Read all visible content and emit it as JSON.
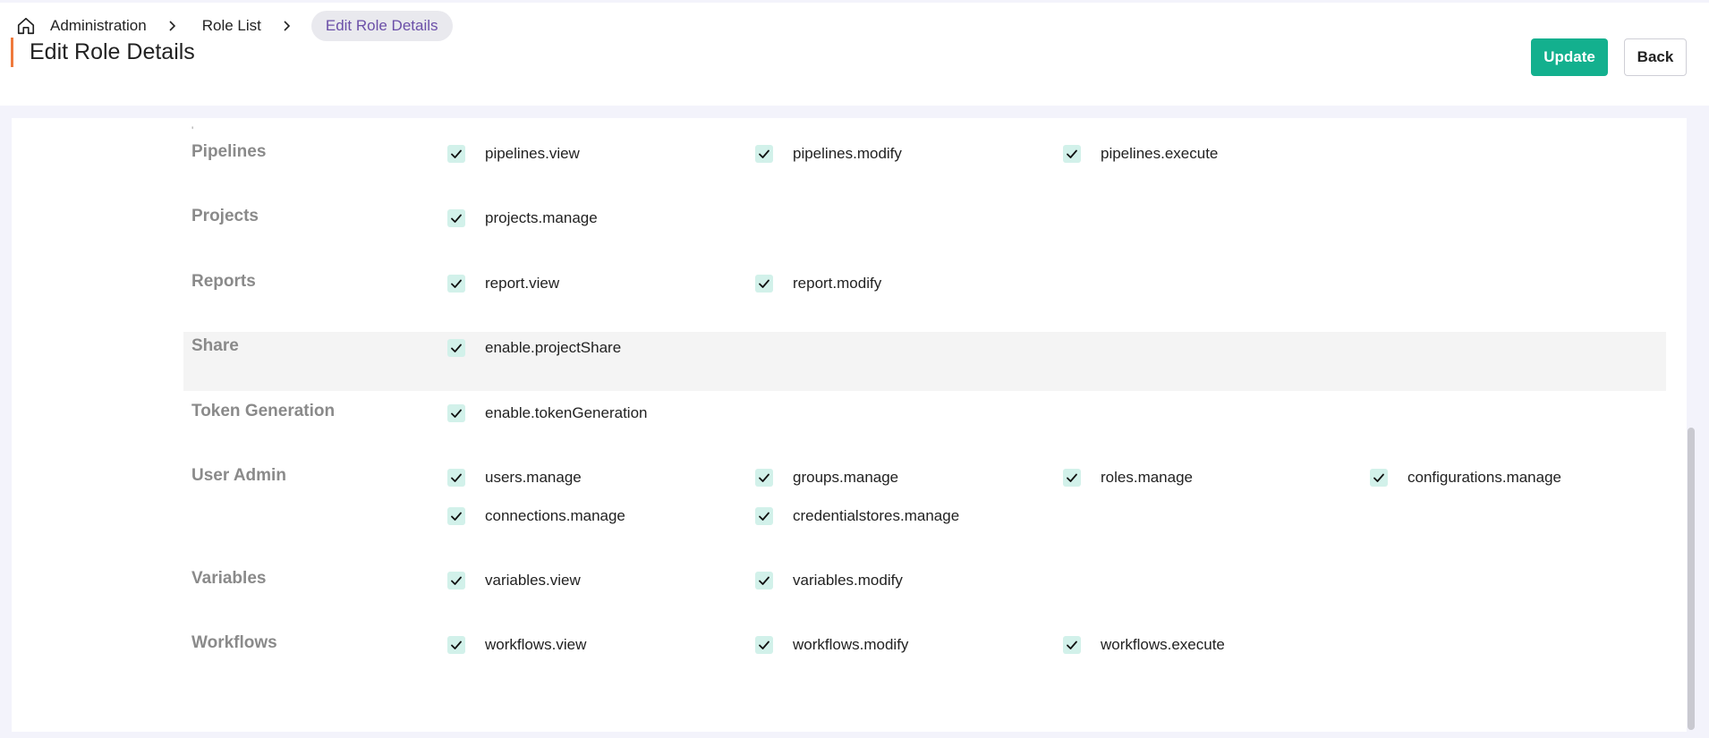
{
  "breadcrumb": {
    "home_icon": "home-icon",
    "items": [
      "Administration",
      "Role List"
    ],
    "current": "Edit Role Details"
  },
  "page": {
    "title": "Edit Role Details",
    "accent_color": "#ef7a3c"
  },
  "actions": {
    "update_label": "Update",
    "back_label": "Back",
    "update_color": "#13b08e"
  },
  "permissions": {
    "clipped_text": "'",
    "groups": [
      {
        "label": "Pipelines",
        "items": [
          "pipelines.view",
          "pipelines.modify",
          "pipelines.execute"
        ]
      },
      {
        "label": "Projects",
        "items": [
          "projects.manage"
        ]
      },
      {
        "label": "Reports",
        "items": [
          "report.view",
          "report.modify"
        ]
      },
      {
        "label": "Share",
        "items": [
          "enable.projectShare"
        ]
      },
      {
        "label": "Token Generation",
        "items": [
          "enable.tokenGeneration"
        ]
      },
      {
        "label": "User Admin",
        "items": [
          "users.manage",
          "groups.manage",
          "roles.manage",
          "configurations.manage",
          "connections.manage",
          "credentialstores.manage"
        ]
      },
      {
        "label": "Variables",
        "items": [
          "variables.view",
          "variables.modify"
        ]
      },
      {
        "label": "Workflows",
        "items": [
          "workflows.view",
          "workflows.modify",
          "workflows.execute"
        ]
      }
    ],
    "checked": true,
    "check_color": "#d2f1ea"
  }
}
